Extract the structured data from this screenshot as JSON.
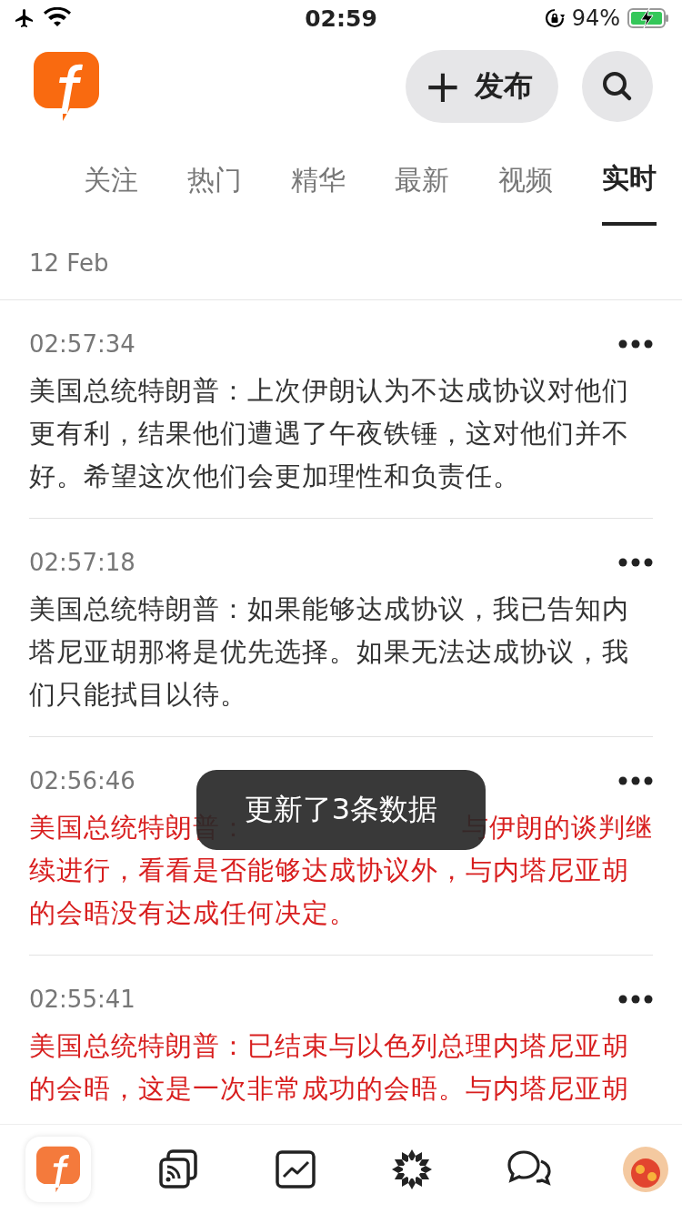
{
  "status_bar": {
    "time": "02:59",
    "battery": "94%"
  },
  "header": {
    "publish_button": {
      "icon": "+",
      "label": "发布"
    }
  },
  "tabs": [
    {
      "label": "关注",
      "selected": false
    },
    {
      "label": "热门",
      "selected": false
    },
    {
      "label": "精华",
      "selected": false
    },
    {
      "label": "最新",
      "selected": false
    },
    {
      "label": "视频",
      "selected": false
    },
    {
      "label": "实时",
      "selected": true
    }
  ],
  "date": "12 Feb",
  "items": [
    {
      "time": "02:57:34",
      "highlight": false,
      "text": "美国总统特朗普：上次伊朗认为不达成协议对他们更有利，结果他们遭遇了午夜铁锤，这对他们并不好。希望这次他们会更加理性和负责任。"
    },
    {
      "time": "02:57:18",
      "highlight": false,
      "text": "美国总统特朗普：如果能够达成协议，我已告知内塔尼亚胡那将是优先选择。如果无法达成协议，我们只能拭目以待。"
    },
    {
      "time": "02:56:46",
      "highlight": true,
      "lead_fragments": [
        "美国总统特朗普：",
        "与伊朗的谈判继"
      ],
      "text": "续进行，看看是否能够达成协议外，与内塔尼亚胡的会晤没有达成任何决定。"
    },
    {
      "time": "02:55:41",
      "highlight": true,
      "text": "美国总统特朗普：已结束与以色列总理内塔尼亚胡的会晤，这是一次非常成功的会晤。与内塔尼亚胡"
    }
  ],
  "toast": {
    "text": "更新了3条数据"
  },
  "bottom_nav": [
    {
      "kind": "home",
      "selected": true
    },
    {
      "kind": "feed",
      "selected": false
    },
    {
      "kind": "chart",
      "selected": false
    },
    {
      "kind": "discover",
      "selected": false
    },
    {
      "kind": "chat",
      "selected": false
    },
    {
      "kind": "avatar",
      "selected": false
    }
  ]
}
